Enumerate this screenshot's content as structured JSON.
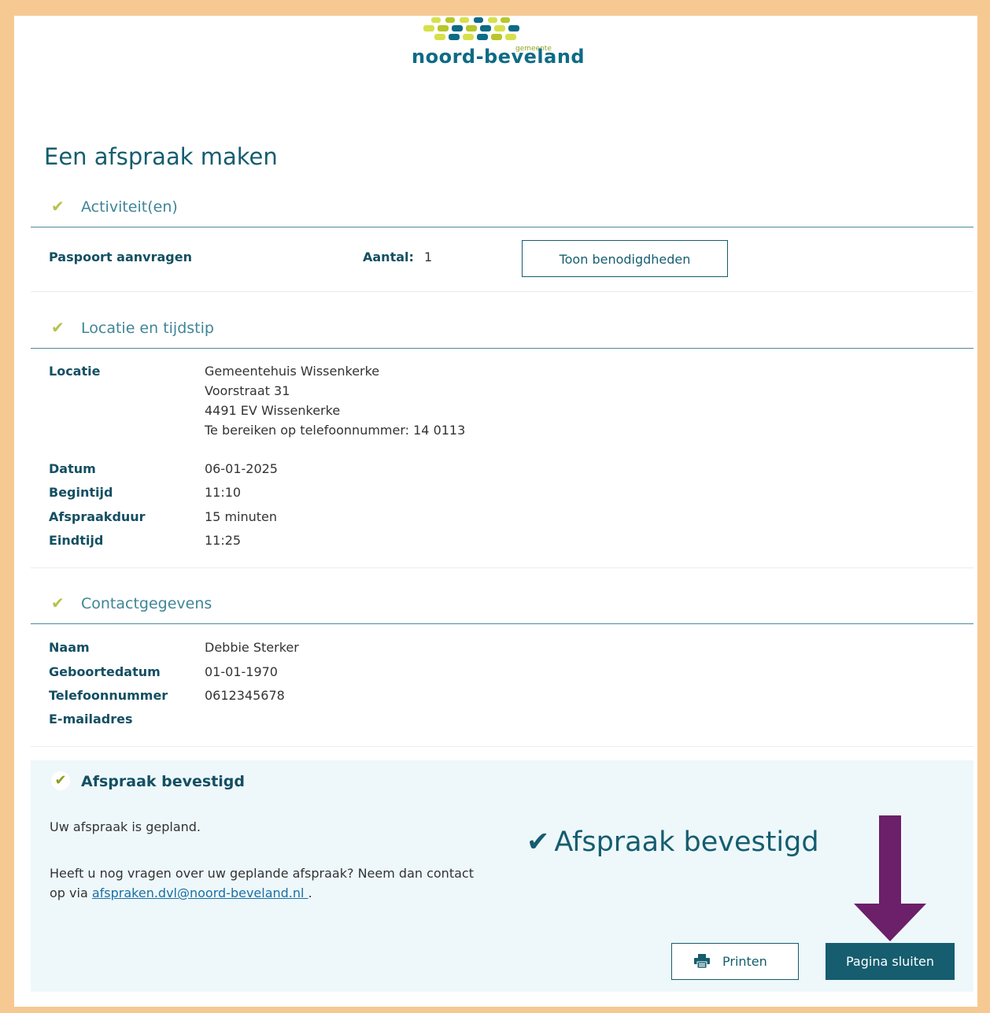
{
  "logo": {
    "name": "noord-beveland",
    "sub": "gemeente"
  },
  "page_title": "Een afspraak maken",
  "sections": {
    "activities": {
      "heading": "Activiteit(en)",
      "product": "Paspoort aanvragen",
      "count_label": "Aantal:",
      "count_value": "1",
      "button_label": "Toon benodigdheden"
    },
    "location_time": {
      "heading": "Locatie en tijdstip",
      "location_label": "Locatie",
      "location_lines": [
        "Gemeentehuis Wissenkerke",
        "Voorstraat 31",
        "4491 EV Wissenkerke",
        "Te bereiken op telefoonnummer: 14 0113"
      ],
      "rows": [
        {
          "label": "Datum",
          "value": "06-01-2025"
        },
        {
          "label": "Begintijd",
          "value": "11:10"
        },
        {
          "label": "Afspraakduur",
          "value": "15 minuten"
        },
        {
          "label": "Eindtijd",
          "value": "11:25"
        }
      ]
    },
    "contact": {
      "heading": "Contactgegevens",
      "rows": [
        {
          "label": "Naam",
          "value": "Debbie Sterker"
        },
        {
          "label": "Geboortedatum",
          "value": "01-01-1970"
        },
        {
          "label": "Telefoonnummer",
          "value": "0612345678"
        },
        {
          "label": "E-mailadres",
          "value": ""
        }
      ]
    }
  },
  "confirmation": {
    "heading": "Afspraak bevestigd",
    "line1": "Uw afspraak is gepland.",
    "line2_a": "Heeft u nog vragen over uw geplande afspraak? Neem dan contact op via",
    "email_link": "afspraken.dvl@noord-beveland.nl ",
    "line2_end": ".",
    "big_text": "Afspraak bevestigd",
    "print_label": "Printen",
    "close_label": "Pagina sluiten"
  },
  "colors": {
    "accent": "#155d6f",
    "check": "#b6c24a",
    "arrow": "#6b2069",
    "border": "#f6c993"
  }
}
